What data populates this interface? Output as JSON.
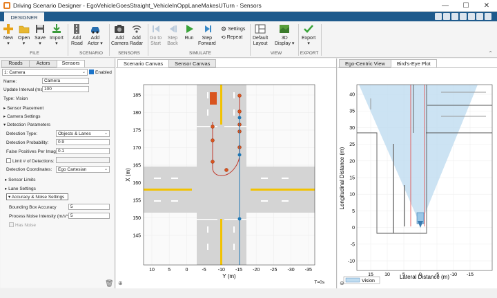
{
  "window": {
    "title": "Driving Scenario Designer - EgoVehicleGoesStraight_VehicleInOppLaneMakesUTurn - Sensors",
    "minimize": "—",
    "maximize": "☐",
    "close": "✕"
  },
  "ribbon_tab": "DESIGNER",
  "ribbon": {
    "file": {
      "label": "FILE",
      "new": "New",
      "open": "Open",
      "save": "Save",
      "import": "Import"
    },
    "scenario": {
      "label": "SCENARIO",
      "add_road_1": "Add",
      "add_road_2": "Road",
      "add_actor_1": "Add",
      "add_actor_2": "Actor"
    },
    "sensors": {
      "label": "SENSORS",
      "add_camera_1": "Add",
      "add_camera_2": "Camera",
      "add_radar_1": "Add",
      "add_radar_2": "Radar"
    },
    "simulate": {
      "label": "SIMULATE",
      "go_to_start_1": "Go to",
      "go_to_start_2": "Start",
      "step_back_1": "Step",
      "step_back_2": "Back",
      "run": "Run",
      "step_forward_1": "Step",
      "step_forward_2": "Forward",
      "settings": "Settings",
      "repeat": "Repeat"
    },
    "view": {
      "label": "VIEW",
      "default_layout_1": "Default",
      "default_layout_2": "Layout",
      "display_3d_1": "3D",
      "display_3d_2": "Display"
    },
    "export": {
      "label": "EXPORT",
      "export": "Export"
    }
  },
  "left_panel": {
    "tabs": [
      "Roads",
      "Actors",
      "Sensors"
    ],
    "sensor_select": "1: Camera",
    "enabled_label": "Enabled",
    "name_label": "Name:",
    "name_value": "Camera",
    "update_interval_label": "Update Interval (ms):",
    "update_interval_value": "100",
    "type_text": "Type: Vision",
    "sensor_placement": "Sensor Placement",
    "camera_settings": "Camera Settings",
    "detection_parameters": "Detection Parameters",
    "detection_type_label": "Detection Type:",
    "detection_type_value": "Objects & Lanes",
    "detection_probability_label": "Detection Probability:",
    "detection_probability_value": "0.9",
    "false_positives_label": "False Positives Per Image:",
    "false_positives_value": "0.1",
    "limit_detections_label": "Limit # of Detections:",
    "detection_coordinates_label": "Detection Coordinates:",
    "detection_coordinates_value": "Ego Cartesian",
    "sensor_limits": "Sensor Limits",
    "lane_settings": "Lane Settings",
    "accuracy_noise": "Accuracy & Noise Settings",
    "bbox_accuracy_label": "Bounding Box Accuracy",
    "bbox_accuracy_value": "5",
    "process_noise_label": "Process Noise Intensity (m/s^2):",
    "process_noise_value": "5",
    "has_noise_label": "Has Noise"
  },
  "canvas": {
    "tabs": [
      "Scenario Canvas",
      "Sensor Canvas"
    ],
    "xlabel": "Y (m)",
    "ylabel": "X (m)",
    "x_ticks": [
      "10",
      "5",
      "0",
      "-5",
      "-10",
      "-15",
      "-20",
      "-25",
      "-30",
      "-35"
    ],
    "y_ticks": [
      "185",
      "180",
      "175",
      "170",
      "165",
      "160",
      "155",
      "150",
      "145"
    ],
    "time": "T=0s"
  },
  "bev": {
    "tabs": [
      "Ego-Centric View",
      "Bird's-Eye Plot"
    ],
    "xlabel": "Lateral Distance (m)",
    "ylabel": "Longitudinal Distance (m)",
    "x_ticks": [
      "15",
      "10",
      "5",
      "0",
      "-5",
      "-10",
      "-15"
    ],
    "y_ticks": [
      "40",
      "35",
      "30",
      "25",
      "20",
      "15",
      "10",
      "5",
      "0",
      "-5",
      "-10"
    ],
    "legend": "Vision"
  },
  "colors": {
    "accent": "#1e5a8c",
    "road": "#d4d4d4",
    "lane_yellow": "#f2c200",
    "ego_blue": "#1f77b4",
    "actor_orange": "#d9541e",
    "path_red": "#c0392b",
    "coverage": "#bfdcf0"
  }
}
